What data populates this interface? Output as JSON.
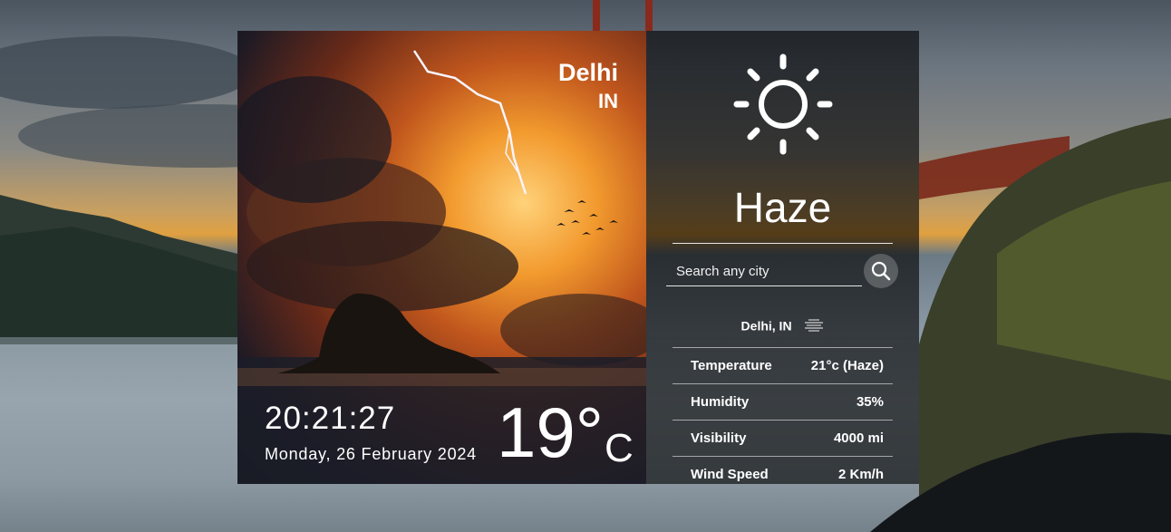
{
  "location": {
    "city": "Delhi",
    "country": "IN"
  },
  "clock": {
    "time": "20:21:27",
    "date": "Monday, 26 February 2024"
  },
  "current": {
    "temperature": "19°",
    "unit": "C",
    "condition": "Haze",
    "condition_icon": "sun-icon"
  },
  "search": {
    "placeholder": "Search any city",
    "value": ""
  },
  "details": {
    "location_label": "Delhi, IN",
    "location_icon": "haze-icon",
    "rows": [
      {
        "label": "Temperature",
        "value": "21°c (Haze)"
      },
      {
        "label": "Humidity",
        "value": "35%"
      },
      {
        "label": "Visibility",
        "value": "4000 mi"
      },
      {
        "label": "Wind Speed",
        "value": "2 Km/h"
      }
    ]
  }
}
